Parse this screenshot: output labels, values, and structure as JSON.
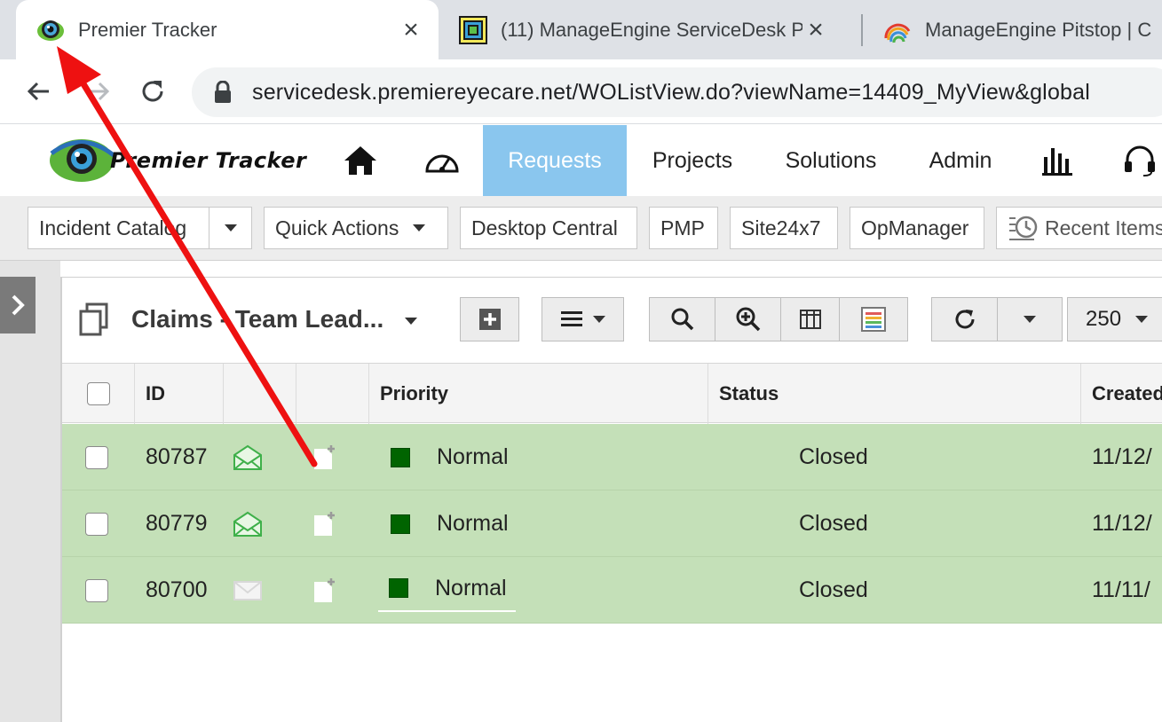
{
  "browser": {
    "tabs": [
      {
        "title": "Premier Tracker",
        "active": true
      },
      {
        "title": "(11) ManageEngine ServiceDesk P",
        "active": false
      },
      {
        "title": "ManageEngine Pitstop | C",
        "active": false
      }
    ],
    "close_glyph": "×",
    "url": "servicedesk.premiereyecare.net/WOListView.do?viewName=14409_MyView&global"
  },
  "app": {
    "logo_text": "Premier Tracker",
    "nav": [
      "Requests",
      "Projects",
      "Solutions",
      "Admin"
    ],
    "active_nav": "Requests",
    "accent_color": "#8ac6ee"
  },
  "toolbar": {
    "incident_catalog": "Incident Catalog",
    "quick_actions": "Quick Actions",
    "desktop_central": "Desktop Central",
    "pmp": "PMP",
    "site24x7": "Site24x7",
    "opmanager": "OpManager",
    "recent_items": "Recent Items"
  },
  "view": {
    "title": "Claims - Team Lead...",
    "page_size": "250"
  },
  "table": {
    "headers": {
      "id": "ID",
      "priority": "Priority",
      "status": "Status",
      "created": "Created"
    },
    "rows": [
      {
        "id": "80787",
        "priority": "Normal",
        "status": "Closed",
        "created": "11/12/",
        "mail_icon": "open-envelope-icon"
      },
      {
        "id": "80779",
        "priority": "Normal",
        "status": "Closed",
        "created": "11/12/",
        "mail_icon": "open-envelope-icon"
      },
      {
        "id": "80700",
        "priority": "Normal",
        "status": "Closed",
        "created": "11/11/",
        "mail_icon": "envelope-icon"
      }
    ],
    "row_color": "#c4e0b8",
    "priority_color": "#006400"
  },
  "annotation": {
    "arrow_color": "#ee1111"
  }
}
